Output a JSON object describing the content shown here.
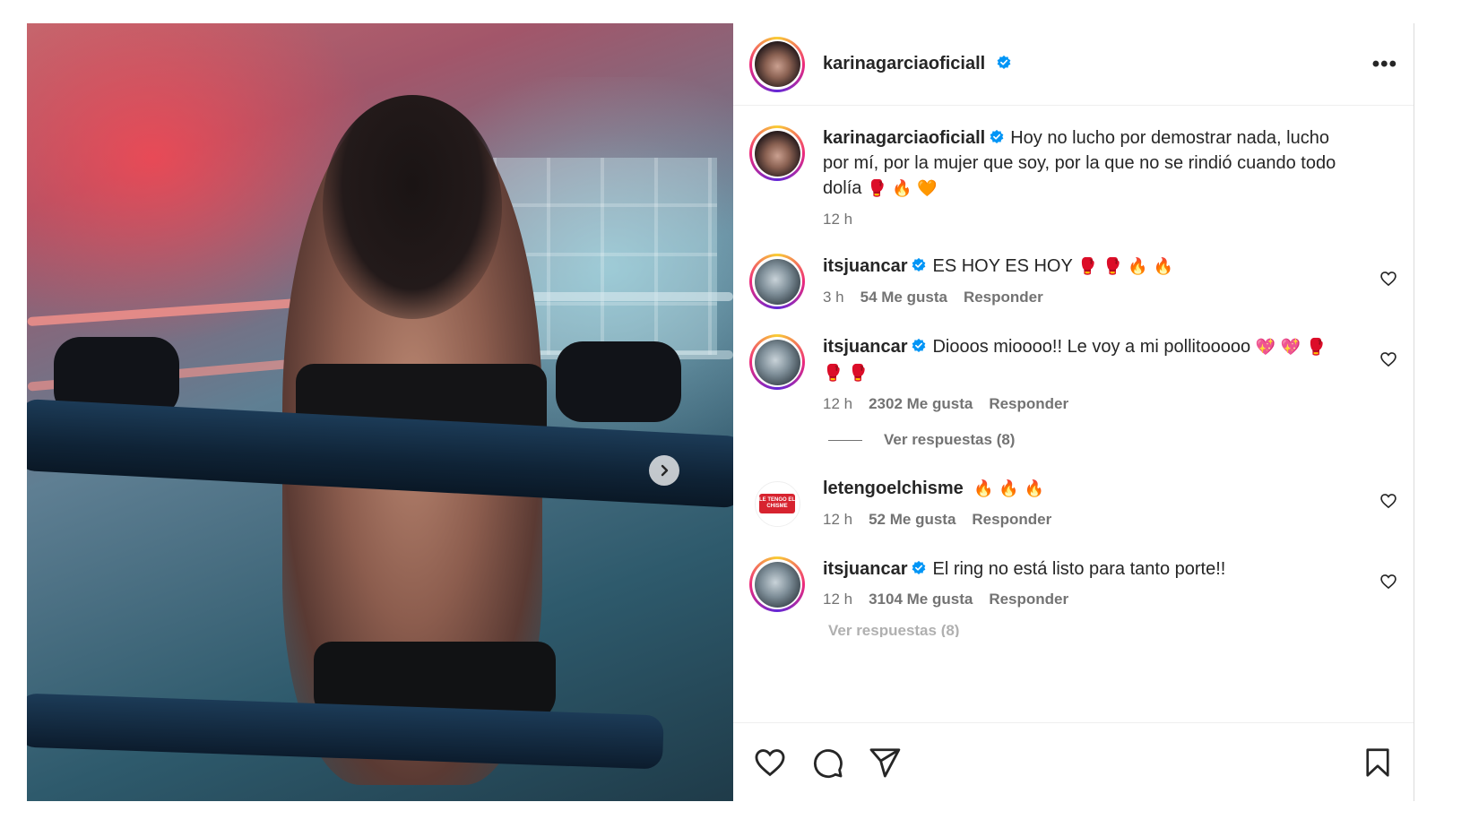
{
  "post": {
    "author": "karinagarciaoficiall",
    "verified": true,
    "more_label": "•••"
  },
  "caption": {
    "user": "karinagarciaoficiall",
    "text": "Hoy no lucho por demostrar nada, lucho por mí, por la mujer que soy, por la que no se rindió cuando todo dolía",
    "emojis": "🥊 🔥 🧡",
    "time": "12 h"
  },
  "comments": [
    {
      "user": "itsjuancar",
      "verified": true,
      "text": "ES HOY ES HOY",
      "emojis": "🥊 🥊 🔥 🔥",
      "time": "3 h",
      "likes": "54 Me gusta",
      "reply": "Responder"
    },
    {
      "user": "itsjuancar",
      "verified": true,
      "text": "Diooos mioooo!! Le voy a mi pollitooooo",
      "emojis": "💖 💖 🥊 🥊 🥊",
      "time": "12 h",
      "likes": "2302 Me gusta",
      "reply": "Responder",
      "view_replies": "Ver respuestas (8)"
    },
    {
      "user": "letengoelchisme",
      "verified": false,
      "text": "",
      "emojis": "🔥 🔥 🔥",
      "time": "12 h",
      "likes": "52 Me gusta",
      "reply": "Responder"
    },
    {
      "user": "itsjuancar",
      "verified": true,
      "text": "El ring no está listo para tanto porte!!",
      "emojis": "",
      "time": "12 h",
      "likes": "3104 Me gusta",
      "reply": "Responder",
      "view_replies": "Ver respuestas (8)"
    }
  ],
  "avatar_logo_text": "LE TENGO EL CHISME",
  "icons": {
    "next": "chevron-right-icon",
    "like": "heart-icon",
    "comment": "comment-icon",
    "share": "send-icon",
    "save": "bookmark-icon",
    "verified": "verified-badge-icon"
  },
  "colors": {
    "verified_blue": "#0095f6",
    "text_primary": "#262626",
    "text_secondary": "#737373",
    "chisme_red": "#d7232f"
  }
}
